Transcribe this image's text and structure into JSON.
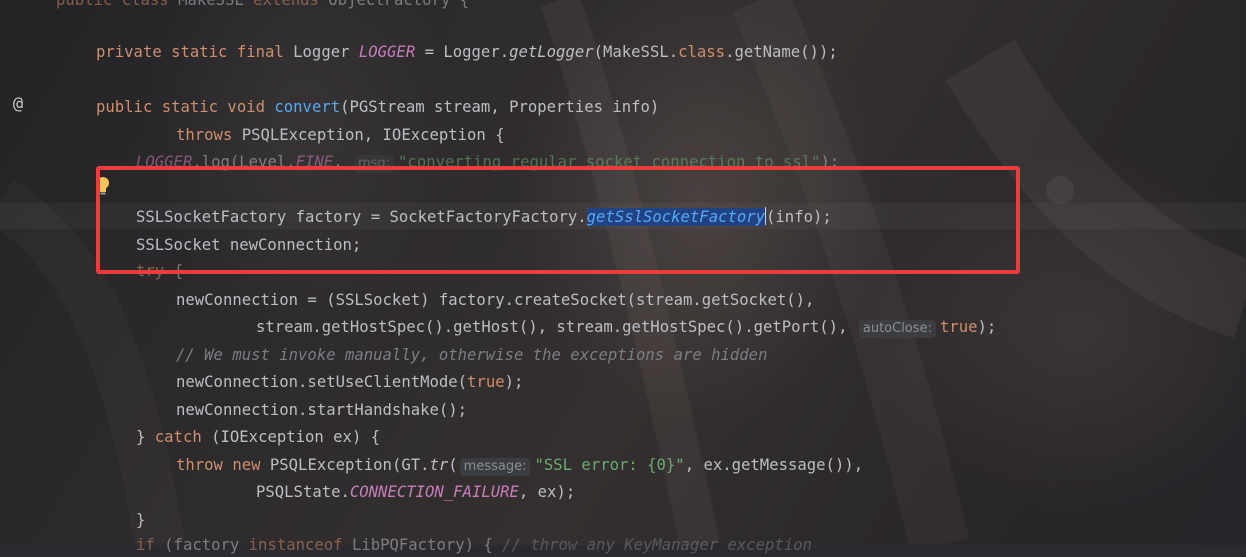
{
  "editor": {
    "gutter_mark": "@",
    "lines": [
      {
        "id": "l0",
        "tokens": [
          [
            "kw",
            "public class "
          ],
          [
            "plain",
            "MakeSSL "
          ],
          [
            "kw",
            "extends "
          ],
          [
            "plain",
            "ObjectFactory {"
          ]
        ]
      },
      {
        "id": "l1",
        "tokens": [
          [
            "kw",
            "private static final "
          ],
          [
            "plain",
            "Logger "
          ],
          [
            "stat",
            "LOGGER"
          ],
          [
            "plain",
            " = Logger."
          ],
          [
            "it",
            "getLogger"
          ],
          [
            "plain",
            "(MakeSSL."
          ],
          [
            "kw",
            "class"
          ],
          [
            "plain",
            ".getName());"
          ]
        ]
      },
      {
        "id": "l2",
        "tokens": [
          [
            "kw",
            "public static void "
          ],
          [
            "fn",
            "convert"
          ],
          [
            "plain",
            "(PGStream stream, Properties info)"
          ]
        ]
      },
      {
        "id": "l3",
        "tokens": [
          [
            "kw",
            "throws "
          ],
          [
            "plain",
            "PSQLException, IOException {"
          ]
        ]
      },
      {
        "id": "l4",
        "tokens": [
          [
            "stat",
            "LOGGER"
          ],
          [
            "plain",
            ".log(Level."
          ],
          [
            "stat",
            "FINE"
          ],
          [
            "plain",
            ", "
          ],
          [
            "hint",
            "msg:"
          ],
          [
            "str",
            "\"converting regular socket connection to ssl\""
          ],
          [
            "plain",
            ");"
          ]
        ]
      },
      {
        "id": "l5",
        "tokens": [
          [
            "plain",
            "SSLSocketFactory factory = SocketFactoryFactory."
          ],
          [
            "sel",
            "getSslSocketFactory"
          ],
          [
            "caret",
            ""
          ],
          [
            "plain",
            "(info);"
          ]
        ]
      },
      {
        "id": "l6",
        "tokens": [
          [
            "plain",
            "SSLSocket newConnection;"
          ]
        ]
      },
      {
        "id": "l7",
        "tokens": [
          [
            "kw",
            "try "
          ],
          [
            "plain",
            "{"
          ]
        ]
      },
      {
        "id": "l8",
        "tokens": [
          [
            "plain",
            "newConnection = (SSLSocket) factory.createSocket(stream.getSocket(),"
          ]
        ]
      },
      {
        "id": "l9",
        "tokens": [
          [
            "plain",
            "stream.getHostSpec().getHost(), stream.getHostSpec().getPort(), "
          ],
          [
            "hint",
            "autoClose:"
          ],
          [
            "kw",
            "true"
          ],
          [
            "plain",
            ");"
          ]
        ]
      },
      {
        "id": "l10",
        "tokens": [
          [
            "cm",
            "// We must invoke manually, otherwise the exceptions are hidden"
          ]
        ]
      },
      {
        "id": "l11",
        "tokens": [
          [
            "plain",
            "newConnection.setUseClientMode("
          ],
          [
            "kw",
            "true"
          ],
          [
            "plain",
            ");"
          ]
        ]
      },
      {
        "id": "l12",
        "tokens": [
          [
            "plain",
            "newConnection.startHandshake();"
          ]
        ]
      },
      {
        "id": "l13",
        "tokens": [
          [
            "plain",
            "} "
          ],
          [
            "kw",
            "catch "
          ],
          [
            "plain",
            "(IOException ex) {"
          ]
        ]
      },
      {
        "id": "l14",
        "tokens": [
          [
            "kw",
            "throw new "
          ],
          [
            "plain",
            "PSQLException(GT."
          ],
          [
            "it",
            "tr"
          ],
          [
            "plain",
            "("
          ],
          [
            "hint",
            "message:"
          ],
          [
            "str",
            "\"SSL error: {0}\""
          ],
          [
            "plain",
            ", ex.getMessage()),"
          ]
        ]
      },
      {
        "id": "l15",
        "tokens": [
          [
            "plain",
            "PSQLState."
          ],
          [
            "stat",
            "CONNECTION_FAILURE"
          ],
          [
            "plain",
            ", ex);"
          ]
        ]
      },
      {
        "id": "l16",
        "tokens": [
          [
            "plain",
            "}"
          ]
        ]
      },
      {
        "id": "l17",
        "tokens": [
          [
            "kw",
            "if "
          ],
          [
            "plain",
            "(factory "
          ],
          [
            "kw",
            "instanceof "
          ],
          [
            "plain",
            "LibPQFactory) { "
          ],
          [
            "cm",
            "// throw any KeyManager exception"
          ]
        ]
      }
    ]
  },
  "colors": {
    "keyword": "#cf8e6d",
    "method_decl": "#56a8f5",
    "static_field": "#c77dbb",
    "string": "#6aab73",
    "comment": "#7a7e85",
    "annotation_box": "#ee3b3b",
    "selection": "#214283"
  }
}
